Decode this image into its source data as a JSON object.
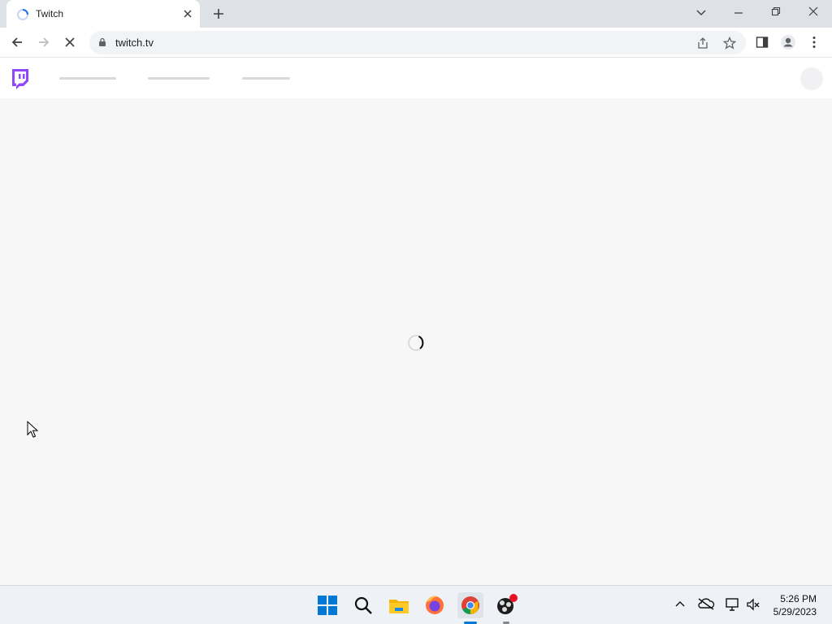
{
  "browser": {
    "tab": {
      "title": "Twitch"
    },
    "address": {
      "url": "twitch.tv"
    }
  },
  "page": {
    "loading": true
  },
  "taskbar": {
    "clock": {
      "time": "5:26 PM",
      "date": "5/29/2023"
    }
  },
  "colors": {
    "twitch_purple": "#9146ff",
    "windows_blue": "#0078d4"
  }
}
